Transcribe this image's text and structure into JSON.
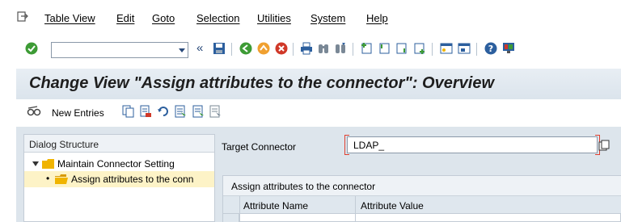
{
  "menu": {
    "items": [
      "Table View",
      "Edit",
      "Goto",
      "Selection",
      "Utilities",
      "System",
      "Help"
    ]
  },
  "toolbar": {
    "command_value": "",
    "back_label": "«"
  },
  "title": "Change View \"Assign attributes to the connector\": Overview",
  "app_toolbar": {
    "new_entries_label": "New Entries"
  },
  "dialog_structure": {
    "header": "Dialog Structure",
    "items": [
      {
        "label": "Maintain Connector Setting"
      },
      {
        "label": "Assign attributes to the conn"
      }
    ]
  },
  "target_connector": {
    "label": "Target Connector",
    "value": "LDAP_"
  },
  "table": {
    "title": "Assign attributes to the connector",
    "columns": [
      "Attribute Name",
      "Attribute Value"
    ]
  },
  "colors": {
    "title_bg": "#dbe4ec",
    "selection": "#fdf3c7",
    "folder": "#f0b400",
    "accent_red": "#e04030"
  }
}
